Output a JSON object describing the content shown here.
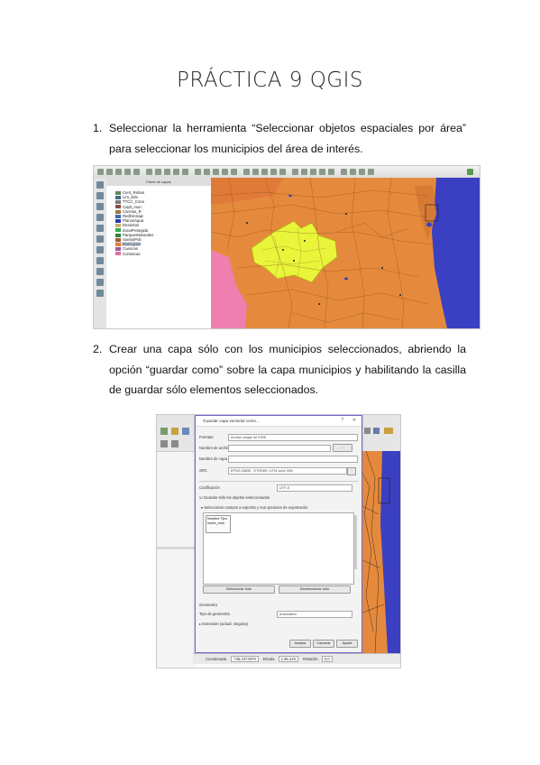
{
  "page": {
    "title": "PRÁCTICA 9 QGIS",
    "steps": [
      {
        "number": "1.",
        "text": "Seleccionar la herramienta “Seleccionar objetos espaciales por área” para seleccionar los municipios del área de interés."
      },
      {
        "number": "2.",
        "text": "Crear una capa sólo con los municipios seleccionados, abriendo la opción “guardar como” sobre la capa municipios y habilitando la casilla de guardar sólo elementos seleccionados."
      }
    ]
  },
  "screenshot1": {
    "panel_title": "Panel de capas",
    "layers": [
      {
        "name": "Cent_Reban",
        "color": "#5a8a5a"
      },
      {
        "name": "Lim_Edo",
        "color": "#4b6b8a"
      },
      {
        "name": "TTCC_Cons",
        "color": "#7a7a7a"
      },
      {
        "name": "Capit_mun",
        "color": "#8a4b4b"
      },
      {
        "name": "Carreas_R",
        "color": "#9a7a3a"
      },
      {
        "name": "RedDrenaje",
        "color": "#3a6aaa"
      },
      {
        "name": "PlanosAgua",
        "color": "#2a3aaa"
      },
      {
        "name": "Desiertos",
        "color": "#c9b26a"
      },
      {
        "name": "ZonaProtegida",
        "color": "#3aaa4a"
      },
      {
        "name": "ParquesNaturales",
        "color": "#2a8a3a"
      },
      {
        "name": "SuelosPob",
        "color": "#aa5a2a"
      },
      {
        "name": "Municipios",
        "color": "#e0803a",
        "selected": true
      },
      {
        "name": "Cuencas",
        "color": "#9a5aa0"
      },
      {
        "name": "Comarcas",
        "color": "#e070a0"
      }
    ],
    "colors": {
      "map_fill": "#e58a3c",
      "selection": "#e8f53a",
      "sea": "#3b3fc2",
      "pink_region": "#ef7fae"
    }
  },
  "screenshot2": {
    "dialog_title": "Guardar capa vectorial como...",
    "labels": {
      "format": "Formato",
      "filename": "Nombre de archivo",
      "layer_name": "Nombre de capa",
      "crs": "SRC",
      "encoding": "Codificación",
      "save_selected": "Guardar sólo los objetos seleccionados",
      "select_fields": "Seleccionar campos a exportar y sus opciones de exportación",
      "geometry": "Geometría",
      "geometry_type": "Tipo de geometría",
      "extent": "Extensión (actual: ninguna)"
    },
    "values": {
      "format": "Archivo shape de ESRI",
      "crs": "EPSG:25830 - ETRS89 / UTM zone 30N",
      "encoding": "UTF-8",
      "geometry_type": "Automático",
      "field_header": "Nombre",
      "field_type": "Tipo",
      "field_value": "nomb_mun"
    },
    "buttons": {
      "browse": "...",
      "select_all": "Seleccionar todo",
      "deselect_all": "Deseleccionar todo",
      "ok": "Aceptar",
      "cancel": "Cancelar",
      "help": "Ayuda"
    },
    "statusbar": {
      "coordinate_label": "Coordenada",
      "coordinate": "736,4374879",
      "scale_label": "Escala",
      "scale": "1:95.226",
      "rotation_label": "Rotación",
      "rotation": "0,0"
    }
  }
}
